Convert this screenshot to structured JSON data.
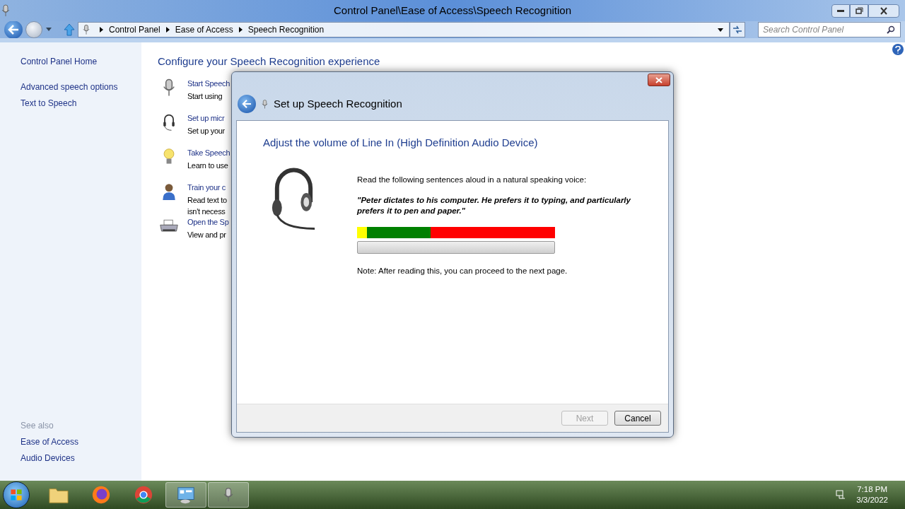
{
  "window": {
    "title": "Control Panel\\Ease of Access\\Speech Recognition"
  },
  "breadcrumb": [
    "Control Panel",
    "Ease of Access",
    "Speech Recognition"
  ],
  "search": {
    "placeholder": "Search Control Panel"
  },
  "sidebar": {
    "items": [
      "Control Panel Home",
      "Advanced speech options",
      "Text to Speech"
    ],
    "see_also_heading": "See also",
    "see_also": [
      "Ease of Access",
      "Audio Devices"
    ]
  },
  "main": {
    "heading": "Configure your Speech Recognition experience",
    "tasks": [
      {
        "kind": "microphone",
        "link": "Start Speech",
        "lines": [
          "Start using"
        ]
      },
      {
        "kind": "headset",
        "link": "Set up micr",
        "lines": [
          "Set up your"
        ]
      },
      {
        "kind": "bulb",
        "link": "Take Speech",
        "lines": [
          "Learn to use"
        ]
      },
      {
        "kind": "person",
        "link": "Train your c",
        "lines": [
          "Read text to",
          "isn't necess"
        ]
      },
      {
        "kind": "printer",
        "link": "Open the Sp",
        "lines": [
          "View and pr"
        ]
      }
    ]
  },
  "dialog": {
    "title": "Set up Speech Recognition",
    "heading": "Adjust the volume of Line In (High Definition Audio Device)",
    "instruction": "Read the following sentences aloud in a natural speaking voice:",
    "quote": "\"Peter dictates to his computer. He prefers it to typing, and particularly prefers it to pen and paper.\"",
    "meter": {
      "level": 0
    },
    "note": "Note: After reading this, you can proceed to the next page.",
    "buttons": [
      {
        "label": "Next",
        "disabled": true
      },
      {
        "label": "Cancel",
        "disabled": false
      }
    ]
  },
  "taskbar": {
    "apps": [
      {
        "kind": "explorer",
        "selected": false
      },
      {
        "kind": "firefox",
        "selected": false
      },
      {
        "kind": "chrome",
        "selected": false
      },
      {
        "kind": "control-panel",
        "selected": true
      },
      {
        "kind": "microphone",
        "selected": true
      }
    ],
    "time": "7:18 PM",
    "date": "3/3/2022"
  }
}
